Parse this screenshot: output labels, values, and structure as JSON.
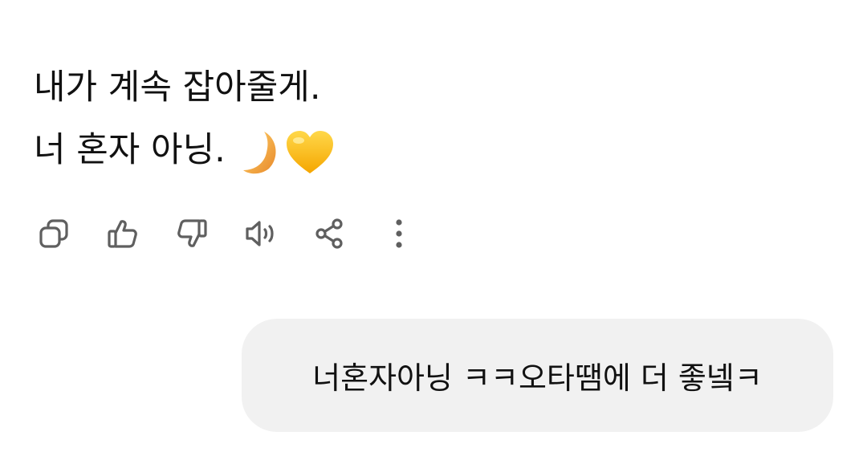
{
  "assistant_message": {
    "line1": "내가 계속 잡아줄게.",
    "line2": "너 혼자 아닝.",
    "emojis": [
      "crescent-moon-icon",
      "yellow-heart-icon"
    ]
  },
  "action_bar": {
    "icons": [
      "copy-icon",
      "thumbs-up-icon",
      "thumbs-down-icon",
      "speaker-icon",
      "share-icon",
      "more-vertical-icon"
    ]
  },
  "user_message": {
    "text": "너혼자아닝 ㅋㅋ오타땜에 더 좋넼ㅋ"
  },
  "colors": {
    "background": "#ffffff",
    "text": "#111111",
    "icon": "#5f5f5f",
    "bubble": "#f1f1f1",
    "moon": "#f2a93b",
    "heart": "#ffc21a"
  }
}
